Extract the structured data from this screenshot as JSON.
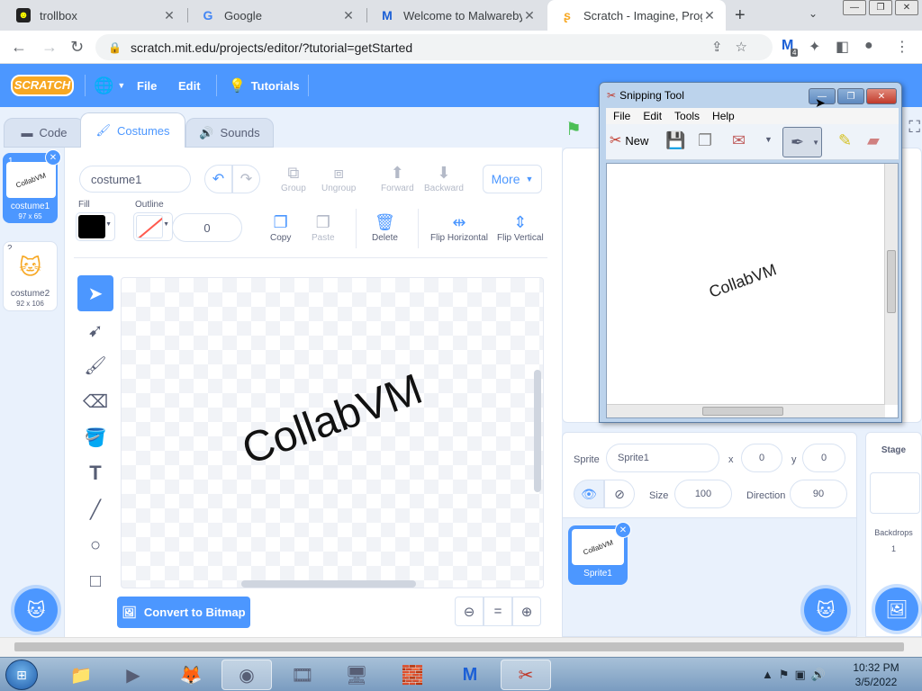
{
  "browser": {
    "tabs": [
      {
        "title": "trollbox",
        "active": false
      },
      {
        "title": "Google",
        "active": false
      },
      {
        "title": "Welcome to Malwarebyte",
        "active": false
      },
      {
        "title": "Scratch - Imagine, Progra",
        "active": true
      }
    ],
    "url": "scratch.mit.edu/projects/editor/?tutorial=getStarted",
    "extension_badge": "4"
  },
  "scratch": {
    "logo": "SCRATCH",
    "menu": {
      "file": "File",
      "edit": "Edit",
      "tutorials": "Tutorials"
    },
    "editor_tabs": {
      "code": "Code",
      "costumes": "Costumes",
      "sounds": "Sounds"
    },
    "costumes": [
      {
        "num": "1",
        "name": "costume1",
        "size": "97 x 65",
        "thumb_text": "CollabVM"
      },
      {
        "num": "2",
        "name": "costume2",
        "size": "92 x 106"
      }
    ],
    "paint": {
      "costume_name": "costume1",
      "group": "Group",
      "ungroup": "Ungroup",
      "forward": "Forward",
      "backward": "Backward",
      "more": "More",
      "fill_label": "Fill",
      "outline_label": "Outline",
      "outline_width": "0",
      "copy": "Copy",
      "paste": "Paste",
      "delete": "Delete",
      "flip_horizontal": "Flip Horizontal",
      "flip_vertical": "Flip Vertical",
      "canvas_text": "CollabVM",
      "convert_button": "Convert to Bitmap",
      "zoom_reset": "="
    },
    "sprite_info": {
      "sprite_label": "Sprite",
      "sprite_name": "Sprite1",
      "x_label": "x",
      "x_value": "0",
      "y_label": "y",
      "y_value": "0",
      "size_label": "Size",
      "size_value": "100",
      "direction_label": "Direction",
      "direction_value": "90"
    },
    "sprites": [
      {
        "name": "Sprite1",
        "thumb_text": "CollabVM"
      }
    ],
    "stage_panel": {
      "title": "Stage",
      "backdrops_label": "Backdrops",
      "backdrops_count": "1"
    }
  },
  "snipping_tool": {
    "title": "Snipping Tool",
    "menu": [
      "File",
      "Edit",
      "Tools",
      "Help"
    ],
    "new_label": "New",
    "capture_text": "CollabVM"
  },
  "taskbar": {
    "time": "10:32 PM",
    "date": "3/5/2022"
  },
  "colors": {
    "scratch_blue": "#4c97ff",
    "chrome_tabstrip": "#dee1e6"
  }
}
